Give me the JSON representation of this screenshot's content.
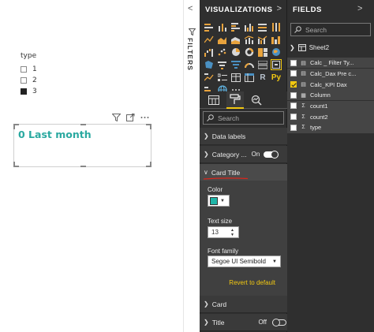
{
  "slicer": {
    "title": "type",
    "items": [
      {
        "label": "1",
        "checked": false
      },
      {
        "label": "2",
        "checked": false
      },
      {
        "label": "3",
        "checked": true
      }
    ]
  },
  "card": {
    "title": "0 Last month",
    "title_color": "#2aa9a0",
    "header_icons": [
      "filter-icon",
      "focus-mode-icon",
      "more-options-icon"
    ]
  },
  "filters": {
    "label": "FILTERS",
    "collapse_glyph": "<"
  },
  "visualizations": {
    "header": "VISUALIZATIONS",
    "expand_glyph": ">",
    "text_icons": {
      "r": "R",
      "py": "Py"
    },
    "search_placeholder": "Search",
    "sections": {
      "data_labels": "Data labels",
      "category": "Category ...",
      "category_toggle": "On",
      "card_title": "Card Title",
      "card": "Card",
      "title": "Title",
      "title_toggle": "Off"
    },
    "card_title_settings": {
      "color_label": "Color",
      "color_value": "#1fb5a8",
      "text_size_label": "Text size",
      "text_size": "13",
      "font_family_label": "Font family",
      "font_family": "Segoe UI Semibold",
      "revert": "Revert to default"
    }
  },
  "fields": {
    "header": "FIELDS",
    "expand_glyph": ">",
    "search_placeholder": "Search",
    "table": "Sheet2",
    "items": [
      {
        "name": "Calc _ Filter Ty...",
        "type": "calc",
        "checked": false
      },
      {
        "name": "Calc_Dax Pre c...",
        "type": "calc",
        "checked": false
      },
      {
        "name": "Calc_KPI Dax",
        "type": "calc",
        "checked": true
      },
      {
        "name": "Column",
        "type": "column",
        "checked": false
      },
      {
        "name": "count1",
        "type": "sum",
        "checked": false
      },
      {
        "name": "count2",
        "type": "sum",
        "checked": false
      },
      {
        "name": "type",
        "type": "sum",
        "checked": false
      }
    ]
  },
  "colors": {
    "panel_bg": "#2f2f2f",
    "accent": "#f2c811",
    "highlight_underline": "#d9261c"
  }
}
